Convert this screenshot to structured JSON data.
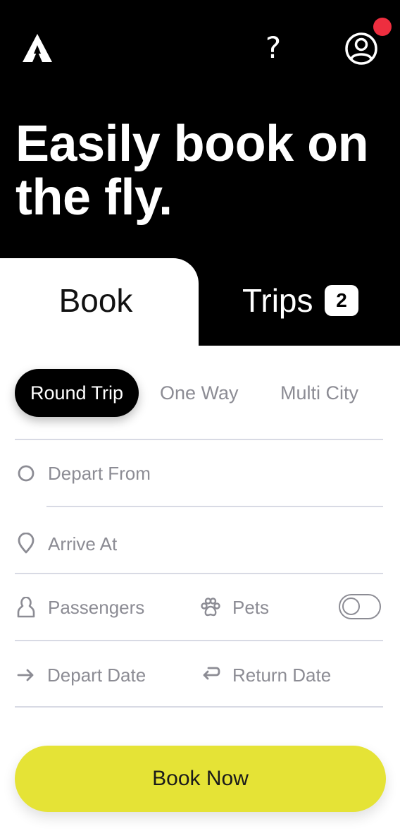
{
  "header": {
    "help_glyph": "?",
    "headline": "Easily book on the fly."
  },
  "tabs": {
    "book_label": "Book",
    "trips_label": "Trips",
    "trips_count": "2"
  },
  "trip_types": {
    "round_trip": "Round Trip",
    "one_way": "One Way",
    "multi_city": "Multi City",
    "selected": "Round Trip"
  },
  "form": {
    "depart_from": "Depart From",
    "arrive_at": "Arrive At",
    "passengers": "Passengers",
    "pets": "Pets",
    "pets_enabled": false,
    "depart_date": "Depart Date",
    "return_date": "Return Date"
  },
  "actions": {
    "book_now": "Book Now"
  },
  "icons": {
    "logo": "logo-a-icon",
    "help": "question-mark-icon",
    "user": "user-profile-icon",
    "depart_from": "circle-icon",
    "arrive_at": "location-pin-icon",
    "passengers": "person-icon",
    "pets": "paw-icon",
    "depart_date": "arrow-right-icon",
    "return_date": "return-arrow-icon"
  },
  "colors": {
    "hero_bg": "#000000",
    "notification": "#ee2e3f",
    "accent": "#e5e336",
    "muted_text": "#8c8c94",
    "divider": "#d8dae4"
  }
}
